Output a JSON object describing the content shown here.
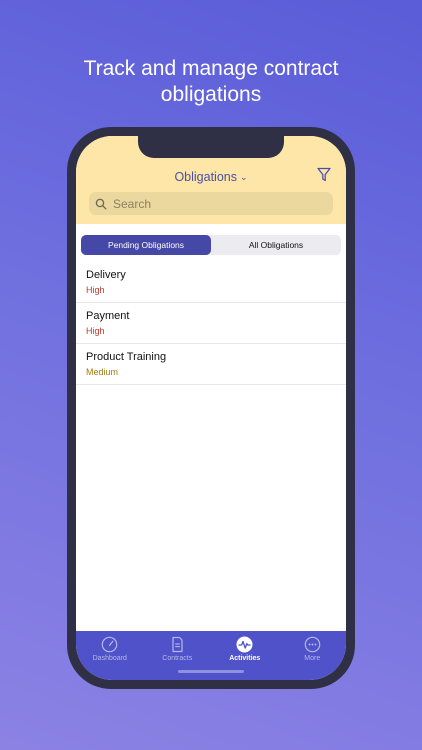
{
  "headline": {
    "line1": "Track and manage contract",
    "line2": "obligations"
  },
  "header": {
    "title": "Obligations",
    "chevron": "⌄"
  },
  "search": {
    "placeholder": "Search"
  },
  "segments": [
    {
      "label": "Pending Obligations",
      "active": true
    },
    {
      "label": "All Obligations",
      "active": false
    }
  ],
  "obligations": [
    {
      "name": "Delivery",
      "priority": "High",
      "color": "#c0392b"
    },
    {
      "name": "Payment",
      "priority": "High",
      "color": "#c0392b"
    },
    {
      "name": "Product Training",
      "priority": "Medium",
      "color": "#a07a12"
    }
  ],
  "tabs": [
    {
      "label": "Dashboard",
      "icon": "gauge-icon"
    },
    {
      "label": "Contracts",
      "icon": "document-icon"
    },
    {
      "label": "Activities",
      "icon": "pulse-icon",
      "active": true
    },
    {
      "label": "More",
      "icon": "more-icon"
    }
  ],
  "colors": {
    "accent": "#4f52c9",
    "header": "#fde6a7",
    "high": "#c0392b",
    "medium": "#a07a12"
  }
}
